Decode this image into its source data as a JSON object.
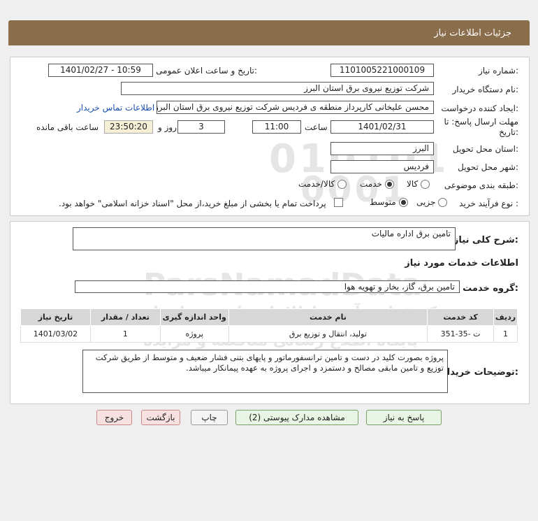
{
  "header": {
    "title": "جزئیات اطلاعات نیاز"
  },
  "form": {
    "need_number_label": "شماره نیاز:",
    "need_number": "1101005221000109",
    "announce_label": "تاریخ و ساعت اعلان عمومی:",
    "announce_value": "1401/02/27 - 10:59",
    "buyer_org_label": "نام دستگاه خریدار:",
    "buyer_org": "شرکت توزیع نیروی برق استان البرز",
    "requester_label": "ایجاد کننده درخواست:",
    "requester": "محسن علیخانی کارپرداز منطقه ی فردیس شرکت توزیع نیروی برق استان البرز",
    "contact_link": "اطلاعات تماس خریدار",
    "deadline_label_1": "مهلت ارسال پاسخ: تا",
    "deadline_label_2": "تاریخ:",
    "deadline_date": "1401/02/31",
    "time_label": "ساعت",
    "deadline_time": "11:00",
    "days_value": "3",
    "days_label": "روز و",
    "remaining_value": "23:50:20",
    "remaining_label": "ساعت باقی مانده",
    "province_label": "استان محل تحویل:",
    "province": "البرز",
    "city_label": "شهر محل تحویل:",
    "city": "فردیس",
    "category_label": "طبقه بندی موضوعی:",
    "category_options": [
      "کالا",
      "خدمت",
      "کالا/خدمت"
    ],
    "category_selected": "خدمت",
    "process_label": "نوع فرآیند خرید :",
    "process_options": [
      "جزیی",
      "متوسط"
    ],
    "process_selected": "متوسط",
    "payment_note": "پرداخت تمام یا بخشی از مبلغ خرید،از محل \"اسناد خزانه اسلامی\" خواهد بود."
  },
  "details": {
    "summary_label": "شرح کلی نیاز:",
    "summary": "تامین برق اداره مالیات",
    "services_heading": "اطلاعات خدمات مورد نیاز",
    "service_group_label": "گروه خدمت:",
    "service_group": "تامین برق، گاز، بخار و تهویه هوا",
    "table_headers": [
      "ردیف",
      "کد خدمت",
      "نام خدمت",
      "واحد اندازه گیری",
      "تعداد / مقدار",
      "تاریخ نیاز"
    ],
    "table_rows": [
      [
        "1",
        "ت -35-351",
        "تولید، انتقال و توزیع برق",
        "پروژه",
        "1",
        "1401/03/02"
      ]
    ],
    "buyer_notes_label": "توضیحات خریدار:",
    "buyer_notes": "پروژه بصورت کلید در دست و تامین ترانسفورماتور و پایهای بتنی فشار ضعیف و متوسط از طریق شرکت توزیع و تامین مابقی مصالح و دستمزد و اجرای پروژه به عهده پیمانکار میباشد."
  },
  "buttons": {
    "reply": "پاسخ به نیاز",
    "attachments": "مشاهده مدارک پیوستی (2)",
    "print": "چاپ",
    "back": "بازگشت",
    "exit": "خروج"
  },
  "watermark": {
    "code": "010101",
    "code2": "0001",
    "brand": "ParsNamadData",
    "line1": "مرکز فراهم آوری اطلاعات پارس نماد داده",
    "line2": "پایگاه اطلاع رسانی مناقصه و مزایده",
    "phone": "۰۲۱-۸۸۳۴۹۶۷۰"
  }
}
